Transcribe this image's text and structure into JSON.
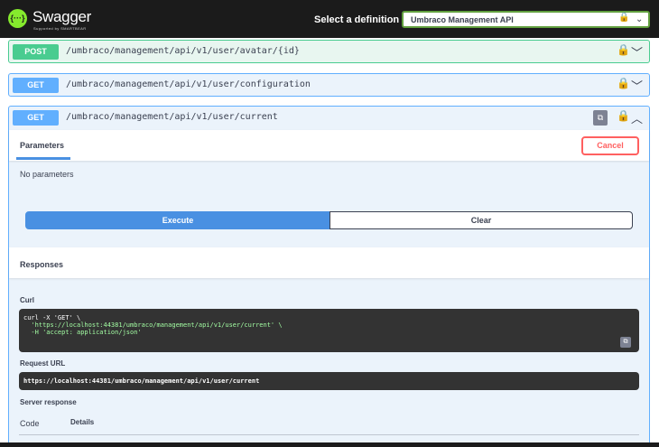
{
  "header": {
    "logo_mark": "{···}",
    "logo_text": "Swagger",
    "logo_sub": "Supported by SMARTBEAR",
    "select_label": "Select a definition",
    "selected_definition": "Umbraco Management API"
  },
  "operations": [
    {
      "method": "POST",
      "path": "/umbraco/management/api/v1/user/avatar/{id}"
    },
    {
      "method": "GET",
      "path": "/umbraco/management/api/v1/user/configuration"
    },
    {
      "method": "GET",
      "path": "/umbraco/management/api/v1/user/current"
    }
  ],
  "expanded": {
    "parameters_tab": "Parameters",
    "cancel_label": "Cancel",
    "no_parameters": "No parameters",
    "execute_label": "Execute",
    "clear_label": "Clear",
    "responses_title": "Responses",
    "curl_label": "Curl",
    "curl_line1": "curl -X 'GET' \\",
    "curl_line2": "  'https://localhost:44381/umbraco/management/api/v1/user/current' \\",
    "curl_line3": "  -H 'accept: application/json'",
    "request_url_label": "Request URL",
    "request_url": "https://localhost:44381/umbraco/management/api/v1/user/current",
    "server_response_label": "Server response",
    "code_header": "Code",
    "details_header": "Details"
  },
  "colors": {
    "post": "#49cc90",
    "get": "#61affe",
    "execute": "#4990e2",
    "cancel": "#ff6060",
    "topbar": "#1b1b1b"
  },
  "icons": [
    "lock-icon",
    "chevron-down-icon",
    "chevron-up-icon",
    "copy-icon"
  ]
}
